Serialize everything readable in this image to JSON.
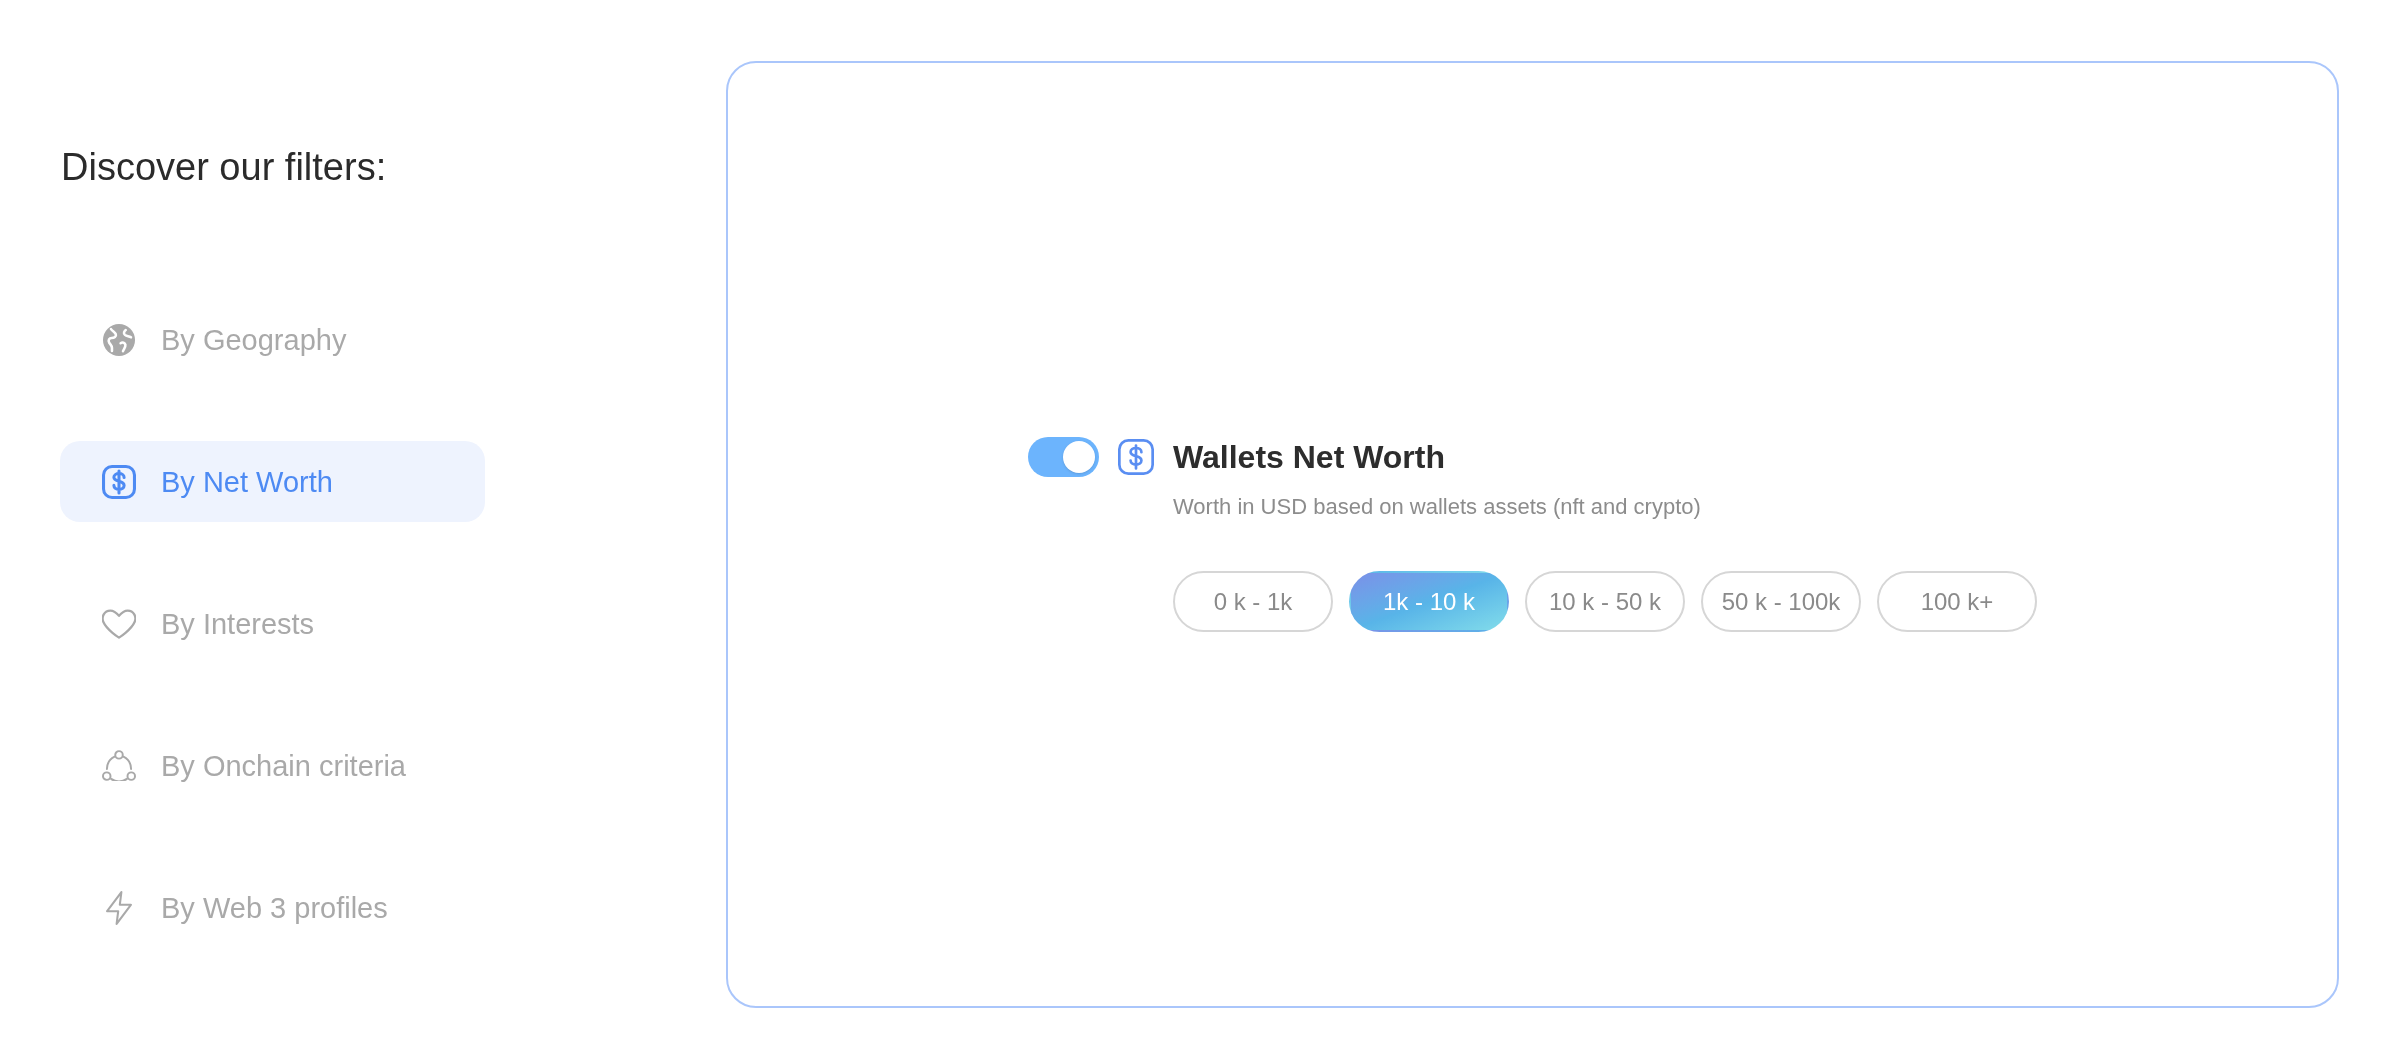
{
  "heading": "Discover our filters:",
  "filters": [
    {
      "label": "By Geography",
      "selected": false
    },
    {
      "label": "By Net Worth",
      "selected": true
    },
    {
      "label": "By Interests",
      "selected": false
    },
    {
      "label": "By Onchain criteria",
      "selected": false
    },
    {
      "label": "By Web 3 profiles",
      "selected": false
    }
  ],
  "panel": {
    "enabled": true,
    "title": "Wallets Net Worth",
    "description": "Worth in USD based on wallets assets (nft and crypto)",
    "ranges": [
      {
        "label": "0 k - 1k",
        "selected": false
      },
      {
        "label": "1k - 10 k",
        "selected": true
      },
      {
        "label": "10 k - 50 k",
        "selected": false
      },
      {
        "label": "50 k - 100k",
        "selected": false
      },
      {
        "label": "100 k+",
        "selected": false
      }
    ]
  }
}
